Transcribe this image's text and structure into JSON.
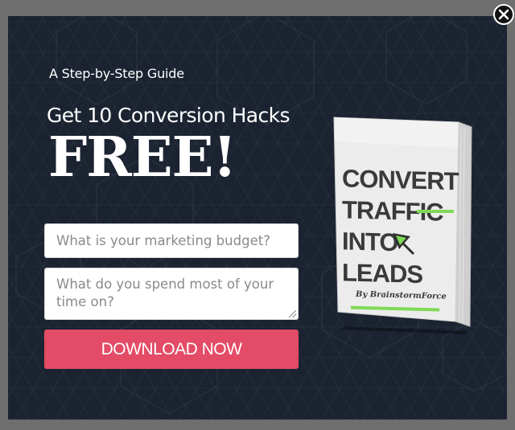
{
  "popup": {
    "subtitle": "A Step-by-Step Guide",
    "headline": "Get 10 Conversion Hacks",
    "free_label": "FREE!",
    "close_icon": "close-icon",
    "form": {
      "budget_placeholder": "What is your marketing budget?",
      "budget_value": "",
      "time_placeholder": "What do you spend most of your time on?",
      "time_value": "",
      "submit_label": "DOWNLOAD NOW"
    },
    "book": {
      "title_lines": [
        "CONVERT",
        "TRAFFIC",
        "INTO",
        "LEADS"
      ],
      "author": "By BrainstormForce"
    }
  },
  "colors": {
    "background": "#1b2331",
    "button": "#e34b66",
    "accent_green": "#7ed957",
    "book_text": "#3a3a3a"
  }
}
